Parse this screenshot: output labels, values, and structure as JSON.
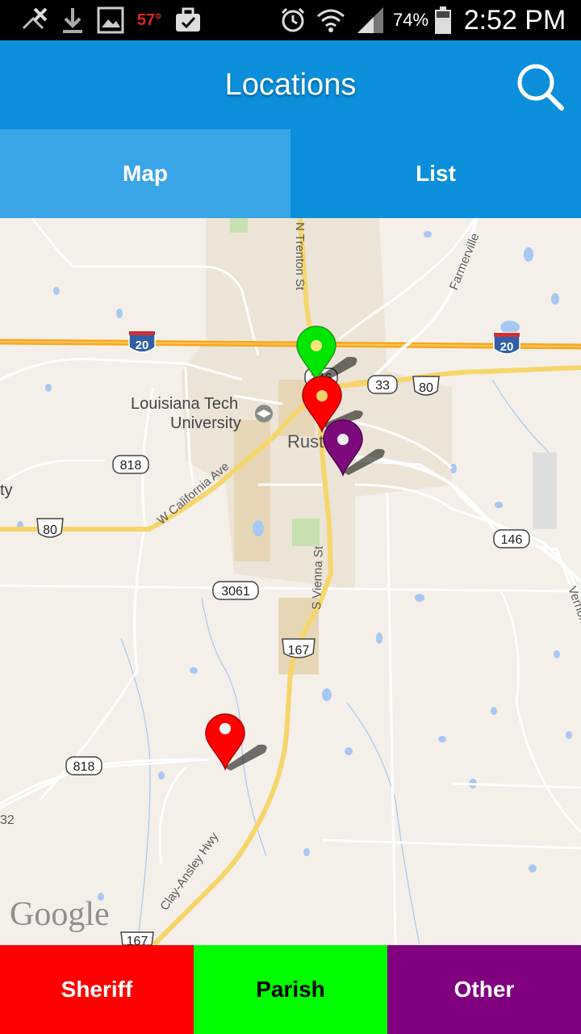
{
  "status_bar": {
    "temperature": "57°",
    "battery": "74%",
    "time": "2:52 PM",
    "icons": [
      "signal-off-icon",
      "download-icon",
      "image-icon",
      "temperature",
      "briefcase-check-icon",
      "alarm-icon",
      "wifi-icon",
      "cell-signal-icon",
      "battery-icon"
    ]
  },
  "app_bar": {
    "title": "Locations",
    "search_icon": "search-icon"
  },
  "tabs": [
    {
      "label": "Map",
      "active": true
    },
    {
      "label": "List",
      "active": false
    }
  ],
  "map": {
    "attribution": "Google",
    "labels": {
      "trenton": "N Trenton St",
      "farmerville": "Farmerville",
      "tech": "Louisiana Tech",
      "university": "University",
      "ruston": "Ruston",
      "california": "W California Ave",
      "vienna": "S Vienna St",
      "clay": "Clay-Ansley Hwy",
      "vernon": "Vernon",
      "ty": "ty",
      "thirtytwo": "32"
    },
    "shields": {
      "i20_west": "20",
      "i20_east": "20",
      "us80_east": "80",
      "us80_west": "80",
      "la33": "33",
      "la146_north": "146",
      "la146_east": "146",
      "la818_north": "818",
      "la818_south": "818",
      "la3061": "3061",
      "us167_mid": "167",
      "us167_south": "167"
    },
    "markers": [
      {
        "category": "Parish",
        "color": "#00e600"
      },
      {
        "category": "Sheriff",
        "color": "#ff0000"
      },
      {
        "category": "Other",
        "color": "#7d0a7d"
      },
      {
        "category": "Sheriff",
        "color": "#ff0000"
      }
    ]
  },
  "legend": [
    {
      "label": "Sheriff",
      "color": "#fe0000"
    },
    {
      "label": "Parish",
      "color": "#00fe00"
    },
    {
      "label": "Other",
      "color": "#800080"
    }
  ]
}
